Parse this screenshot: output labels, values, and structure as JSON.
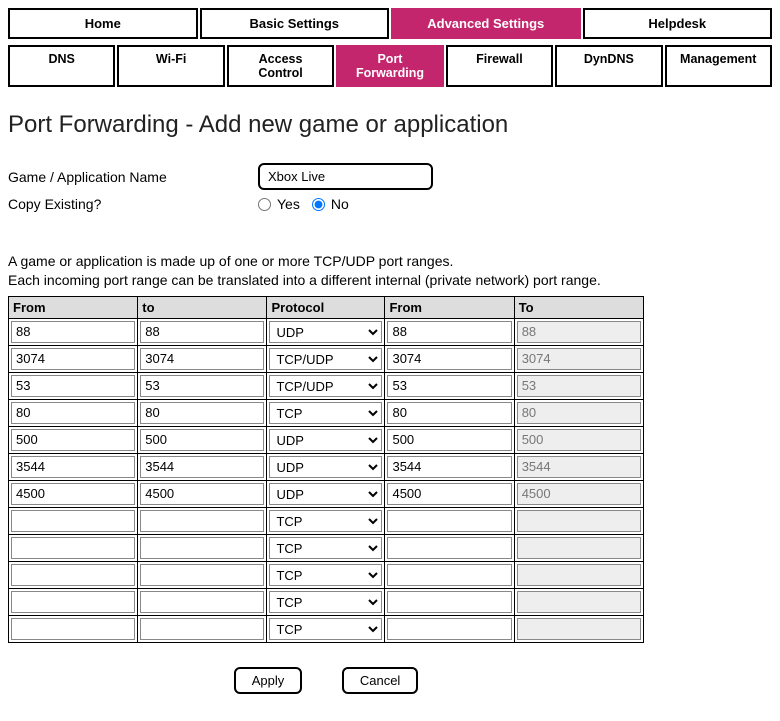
{
  "top_nav": [
    {
      "label": "Home",
      "active": false
    },
    {
      "label": "Basic Settings",
      "active": false
    },
    {
      "label": "Advanced Settings",
      "active": true
    },
    {
      "label": "Helpdesk",
      "active": false
    }
  ],
  "sub_nav": [
    {
      "label": "DNS",
      "active": false
    },
    {
      "label": "Wi-Fi",
      "active": false
    },
    {
      "label": "Access Control",
      "active": false
    },
    {
      "label": "Port Forwarding",
      "active": true
    },
    {
      "label": "Firewall",
      "active": false
    },
    {
      "label": "DynDNS",
      "active": false
    },
    {
      "label": "Management",
      "active": false
    }
  ],
  "page_title": "Port Forwarding - Add new game or application",
  "form": {
    "name_label": "Game / Application Name",
    "name_value": "Xbox Live",
    "copy_label": "Copy Existing?",
    "yes_label": "Yes",
    "no_label": "No",
    "copy_selected": "no"
  },
  "desc_line1": "A game or application is made up of one or more TCP/UDP port ranges.",
  "desc_line2": "Each incoming port range can be translated into a different internal (private network) port range.",
  "table": {
    "headers": [
      "From",
      "to",
      "Protocol",
      "From",
      "To"
    ],
    "protocol_options": [
      "TCP",
      "UDP",
      "TCP/UDP"
    ],
    "rows": [
      {
        "from1": "88",
        "to1": "88",
        "proto": "UDP",
        "from2": "88",
        "to2": "88"
      },
      {
        "from1": "3074",
        "to1": "3074",
        "proto": "TCP/UDP",
        "from2": "3074",
        "to2": "3074"
      },
      {
        "from1": "53",
        "to1": "53",
        "proto": "TCP/UDP",
        "from2": "53",
        "to2": "53"
      },
      {
        "from1": "80",
        "to1": "80",
        "proto": "TCP",
        "from2": "80",
        "to2": "80"
      },
      {
        "from1": "500",
        "to1": "500",
        "proto": "UDP",
        "from2": "500",
        "to2": "500"
      },
      {
        "from1": "3544",
        "to1": "3544",
        "proto": "UDP",
        "from2": "3544",
        "to2": "3544"
      },
      {
        "from1": "4500",
        "to1": "4500",
        "proto": "UDP",
        "from2": "4500",
        "to2": "4500"
      },
      {
        "from1": "",
        "to1": "",
        "proto": "TCP",
        "from2": "",
        "to2": ""
      },
      {
        "from1": "",
        "to1": "",
        "proto": "TCP",
        "from2": "",
        "to2": ""
      },
      {
        "from1": "",
        "to1": "",
        "proto": "TCP",
        "from2": "",
        "to2": ""
      },
      {
        "from1": "",
        "to1": "",
        "proto": "TCP",
        "from2": "",
        "to2": ""
      },
      {
        "from1": "",
        "to1": "",
        "proto": "TCP",
        "from2": "",
        "to2": ""
      }
    ]
  },
  "buttons": {
    "apply": "Apply",
    "cancel": "Cancel"
  }
}
